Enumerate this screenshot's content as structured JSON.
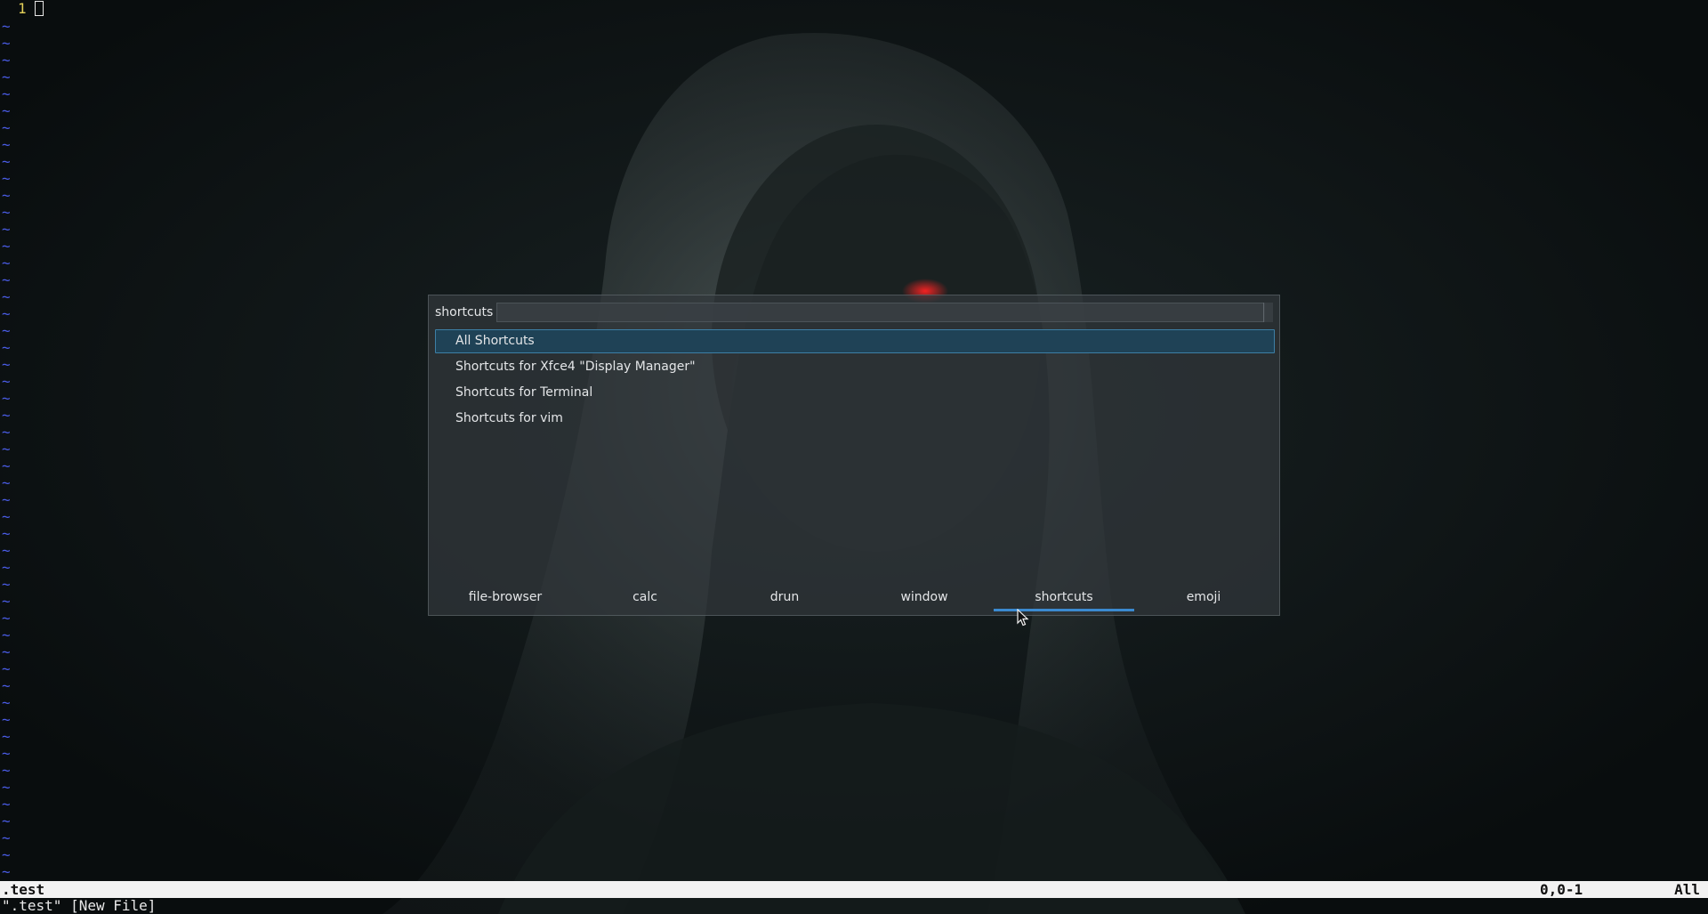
{
  "editor": {
    "line_number": "1",
    "empty_line_marker": "~",
    "status": {
      "filename": ".test",
      "position": "0,0-1",
      "scroll": "All"
    },
    "message": "\".test\" [New File]"
  },
  "launcher": {
    "prompt": "shortcuts",
    "search_value": "",
    "results": [
      {
        "label": "All Shortcuts",
        "selected": true
      },
      {
        "label": "Shortcuts for Xfce4 \"Display Manager\"",
        "selected": false
      },
      {
        "label": "Shortcuts for Terminal",
        "selected": false
      },
      {
        "label": "Shortcuts for vim",
        "selected": false
      }
    ],
    "modes": [
      {
        "label": "file-browser"
      },
      {
        "label": "calc"
      },
      {
        "label": "drun"
      },
      {
        "label": "window"
      },
      {
        "label": "shortcuts",
        "active": true
      },
      {
        "label": "emoji"
      }
    ]
  },
  "colors": {
    "line_number": "#e6d25a",
    "tilde": "#4a5ce6",
    "selection_bg": "#1f4256",
    "selection_border": "#3d7fa6",
    "active_tab_underline": "#3b8ad0"
  }
}
